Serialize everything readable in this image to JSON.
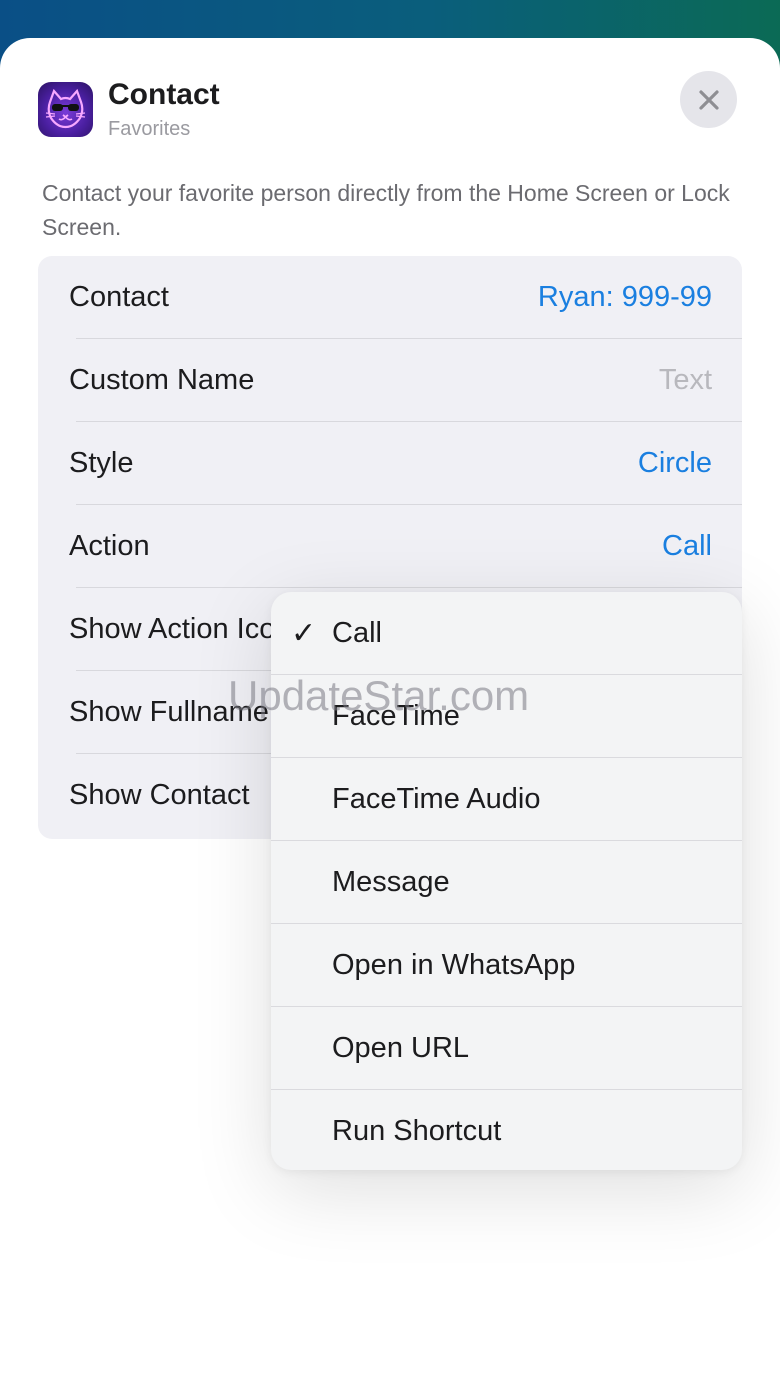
{
  "header": {
    "app_title": "Contact",
    "app_subtitle": "Favorites",
    "icon": "neon-cat-icon",
    "close_icon": "close-icon"
  },
  "description": "Contact your favorite person directly from the Home Screen or Lock Screen.",
  "settings": {
    "rows": [
      {
        "label": "Contact",
        "value": "Ryan: 999-99"
      },
      {
        "label": "Custom Name",
        "value": "Text",
        "placeholder": true
      },
      {
        "label": "Style",
        "value": "Circle"
      },
      {
        "label": "Action",
        "value": "Call"
      },
      {
        "label": "Show Action Icon",
        "value": ""
      },
      {
        "label": "Show Fullname",
        "value": ""
      },
      {
        "label": "Show Contact",
        "value": ""
      }
    ]
  },
  "action_menu": {
    "selected": "Call",
    "items": [
      {
        "label": "Call",
        "checked": true
      },
      {
        "label": "FaceTime",
        "checked": false
      },
      {
        "label": "FaceTime Audio",
        "checked": false
      },
      {
        "label": "Message",
        "checked": false
      },
      {
        "label": "Open in WhatsApp",
        "checked": false
      },
      {
        "label": "Open URL",
        "checked": false
      },
      {
        "label": "Run Shortcut",
        "checked": false
      }
    ],
    "check_glyph": "✓"
  },
  "watermark": "UpdateStar.com",
  "colors": {
    "accent": "#1a7fe0",
    "sheet_background": "#ffffff",
    "group_background": "#f0f0f5"
  }
}
